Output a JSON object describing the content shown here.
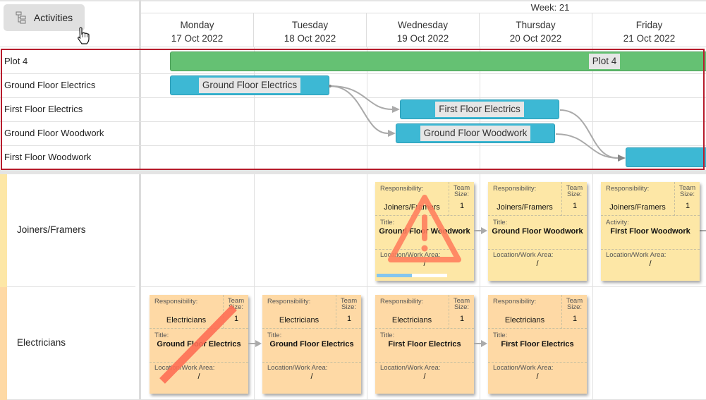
{
  "toolbar": {
    "activities_label": "Activities",
    "activities_icon": "gantt-tree-icon"
  },
  "timeline": {
    "week_label": "Week: 21",
    "days": [
      {
        "name": "Monday",
        "date": "17 Oct 2022"
      },
      {
        "name": "Tuesday",
        "date": "18 Oct 2022"
      },
      {
        "name": "Wednesday",
        "date": "19 Oct 2022"
      },
      {
        "name": "Thursday",
        "date": "20 Oct 2022"
      },
      {
        "name": "Friday",
        "date": "21 Oct 2022"
      }
    ]
  },
  "gantt": {
    "rows": [
      {
        "label": "Plot 4",
        "bar_label": "Plot 4",
        "color": "#65c173"
      },
      {
        "label": "Ground Floor Electrics",
        "bar_label": "Ground Floor Electrics",
        "color": "#3db8d4"
      },
      {
        "label": "First Floor Electrics",
        "bar_label": "First Floor Electrics",
        "color": "#3db8d4"
      },
      {
        "label": "Ground Floor Woodwork",
        "bar_label": "Ground Floor Woodwork",
        "color": "#3db8d4"
      },
      {
        "label": "First Floor Woodwork",
        "bar_label": "",
        "color": "#3db8d4"
      }
    ],
    "selection_color": "#b71c2c"
  },
  "resources": [
    {
      "name": "Joiners/Framers",
      "color": "#fde7a6",
      "cards": [
        {
          "day": "Wednesday",
          "resp_label": "Responsibility:",
          "resp": "Joiners/Framers",
          "team_label": "Team Size:",
          "team": "1",
          "title_label": "Title:",
          "title": "Ground Floor Woodwork",
          "loc_label": "Location/Work Area:",
          "loc": "/",
          "warning": true,
          "progress_percent": 50
        },
        {
          "day": "Thursday",
          "resp_label": "Responsibility:",
          "resp": "Joiners/Framers",
          "team_label": "Team Size:",
          "team": "1",
          "title_label": "Title:",
          "title": "Ground Floor Woodwork",
          "loc_label": "Location/Work Area:",
          "loc": "/"
        },
        {
          "day": "Friday",
          "resp_label": "Responsibility:",
          "resp": "Joiners/Framers",
          "team_label": "Team Size:",
          "team": "1",
          "title_label": "Activity:",
          "title": "First Floor Woodwork",
          "loc_label": "Location/Work Area:",
          "loc": "/"
        }
      ]
    },
    {
      "name": "Electricians",
      "color": "#fed9a5",
      "cards": [
        {
          "day": "Monday",
          "resp_label": "Responsibility:",
          "resp": "Electricians",
          "team_label": "Team Size:",
          "team": "1",
          "title_label": "Title:",
          "title": "Ground Floor Electrics",
          "loc_label": "Location/Work Area:",
          "loc": "/",
          "struck": true
        },
        {
          "day": "Tuesday",
          "resp_label": "Responsibility:",
          "resp": "Electricians",
          "team_label": "Team Size:",
          "team": "1",
          "title_label": "Title:",
          "title": "Ground Floor Electrics",
          "loc_label": "Location/Work Area:",
          "loc": "/"
        },
        {
          "day": "Wednesday",
          "resp_label": "Responsibility:",
          "resp": "Electricians",
          "team_label": "Team Size:",
          "team": "1",
          "title_label": "Title:",
          "title": "First Floor Electrics",
          "loc_label": "Location/Work Area:",
          "loc": "/"
        },
        {
          "day": "Thursday",
          "resp_label": "Responsibility:",
          "resp": "Electricians",
          "team_label": "Team Size:",
          "team": "1",
          "title_label": "Title:",
          "title": "First Floor Electrics",
          "loc_label": "Location/Work Area:",
          "loc": "/"
        }
      ]
    }
  ]
}
